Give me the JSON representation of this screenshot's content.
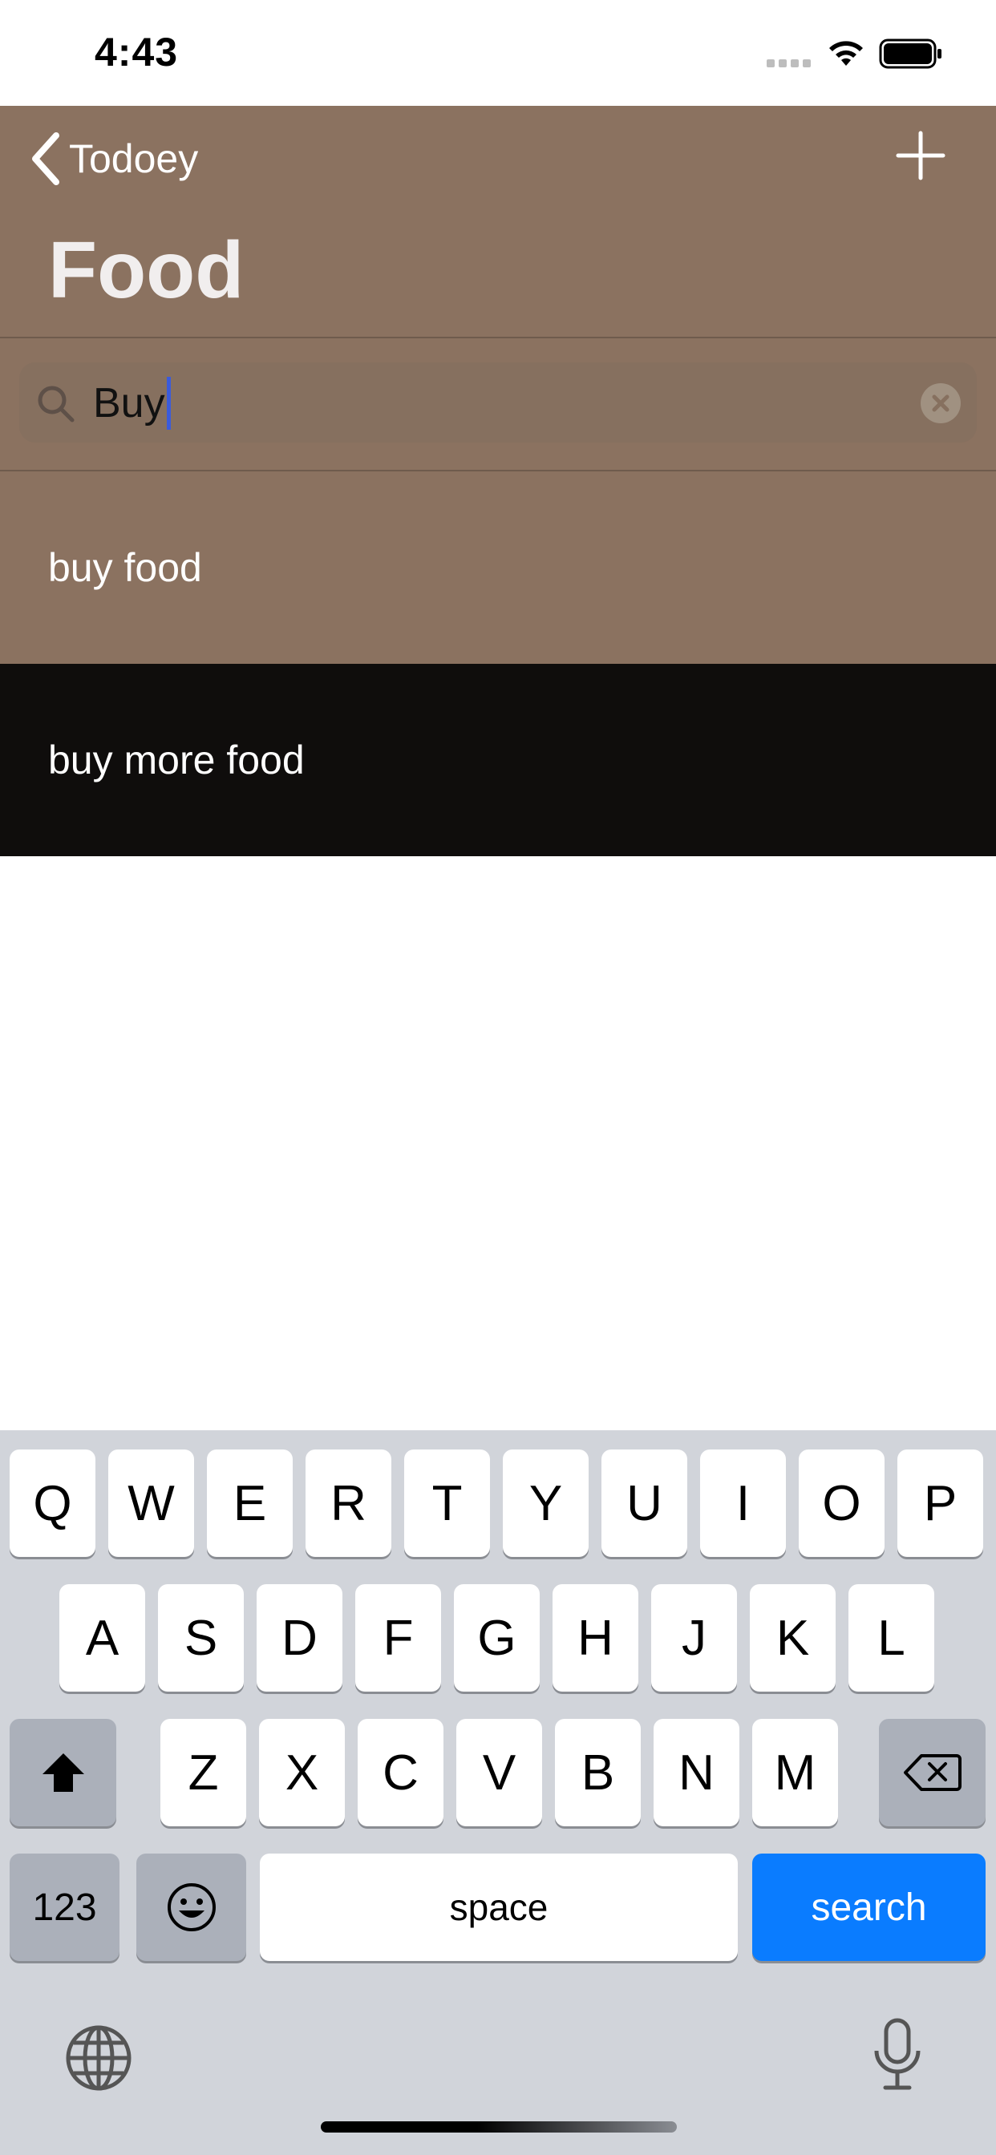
{
  "status_bar": {
    "time": "4:43"
  },
  "nav": {
    "back_label": "Todoey",
    "title": "Food"
  },
  "search": {
    "value": "Buy"
  },
  "items": [
    {
      "label": "buy food",
      "bg": "#8b7260"
    },
    {
      "label": "buy more food",
      "bg": "#0f0d0c"
    }
  ],
  "keyboard": {
    "row1": [
      "Q",
      "W",
      "E",
      "R",
      "T",
      "Y",
      "U",
      "I",
      "O",
      "P"
    ],
    "row2": [
      "A",
      "S",
      "D",
      "F",
      "G",
      "H",
      "J",
      "K",
      "L"
    ],
    "row3": [
      "Z",
      "X",
      "C",
      "V",
      "B",
      "N",
      "M"
    ],
    "numbers_label": "123",
    "space_label": "space",
    "search_label": "search"
  },
  "colors": {
    "nav": "#8b7260",
    "accent": "#0a7cff"
  },
  "icons": [
    "chevron-left-icon",
    "plus-icon",
    "search-icon",
    "clear-icon",
    "shift-icon",
    "backspace-icon",
    "emoji-icon",
    "globe-icon",
    "microphone-icon"
  ]
}
